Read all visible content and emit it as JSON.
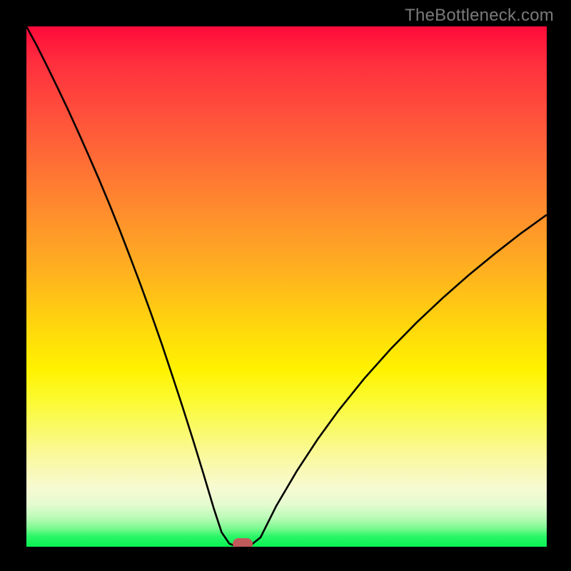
{
  "watermark": "TheBottleneck.com",
  "chart_data": {
    "type": "line",
    "title": "",
    "xlabel": "",
    "ylabel": "",
    "xlim": [
      0,
      100
    ],
    "ylim": [
      0,
      100
    ],
    "grid": false,
    "legend": false,
    "marker": {
      "x": 41.5,
      "y": 0.5
    },
    "series": [
      {
        "name": "bottleneck-curve",
        "x": [
          0,
          2,
          4,
          6,
          8,
          10,
          12,
          14,
          16,
          18,
          20,
          22,
          24,
          26,
          28,
          30,
          32,
          34,
          36,
          37.5,
          39,
          40,
          41,
          42,
          43,
          45,
          48,
          52,
          56,
          60,
          65,
          70,
          75,
          80,
          85,
          90,
          95,
          100
        ],
        "y": [
          100,
          96.3,
          92.3,
          88.2,
          84.0,
          79.6,
          75.1,
          70.5,
          65.7,
          60.7,
          55.5,
          50.2,
          44.7,
          39.0,
          33.0,
          26.9,
          20.6,
          14.1,
          7.4,
          2.8,
          0.6,
          0.2,
          0.2,
          0.2,
          0.2,
          1.8,
          7.8,
          14.6,
          20.7,
          26.2,
          32.4,
          38.0,
          43.1,
          47.8,
          52.2,
          56.3,
          60.2,
          63.8
        ]
      }
    ]
  }
}
